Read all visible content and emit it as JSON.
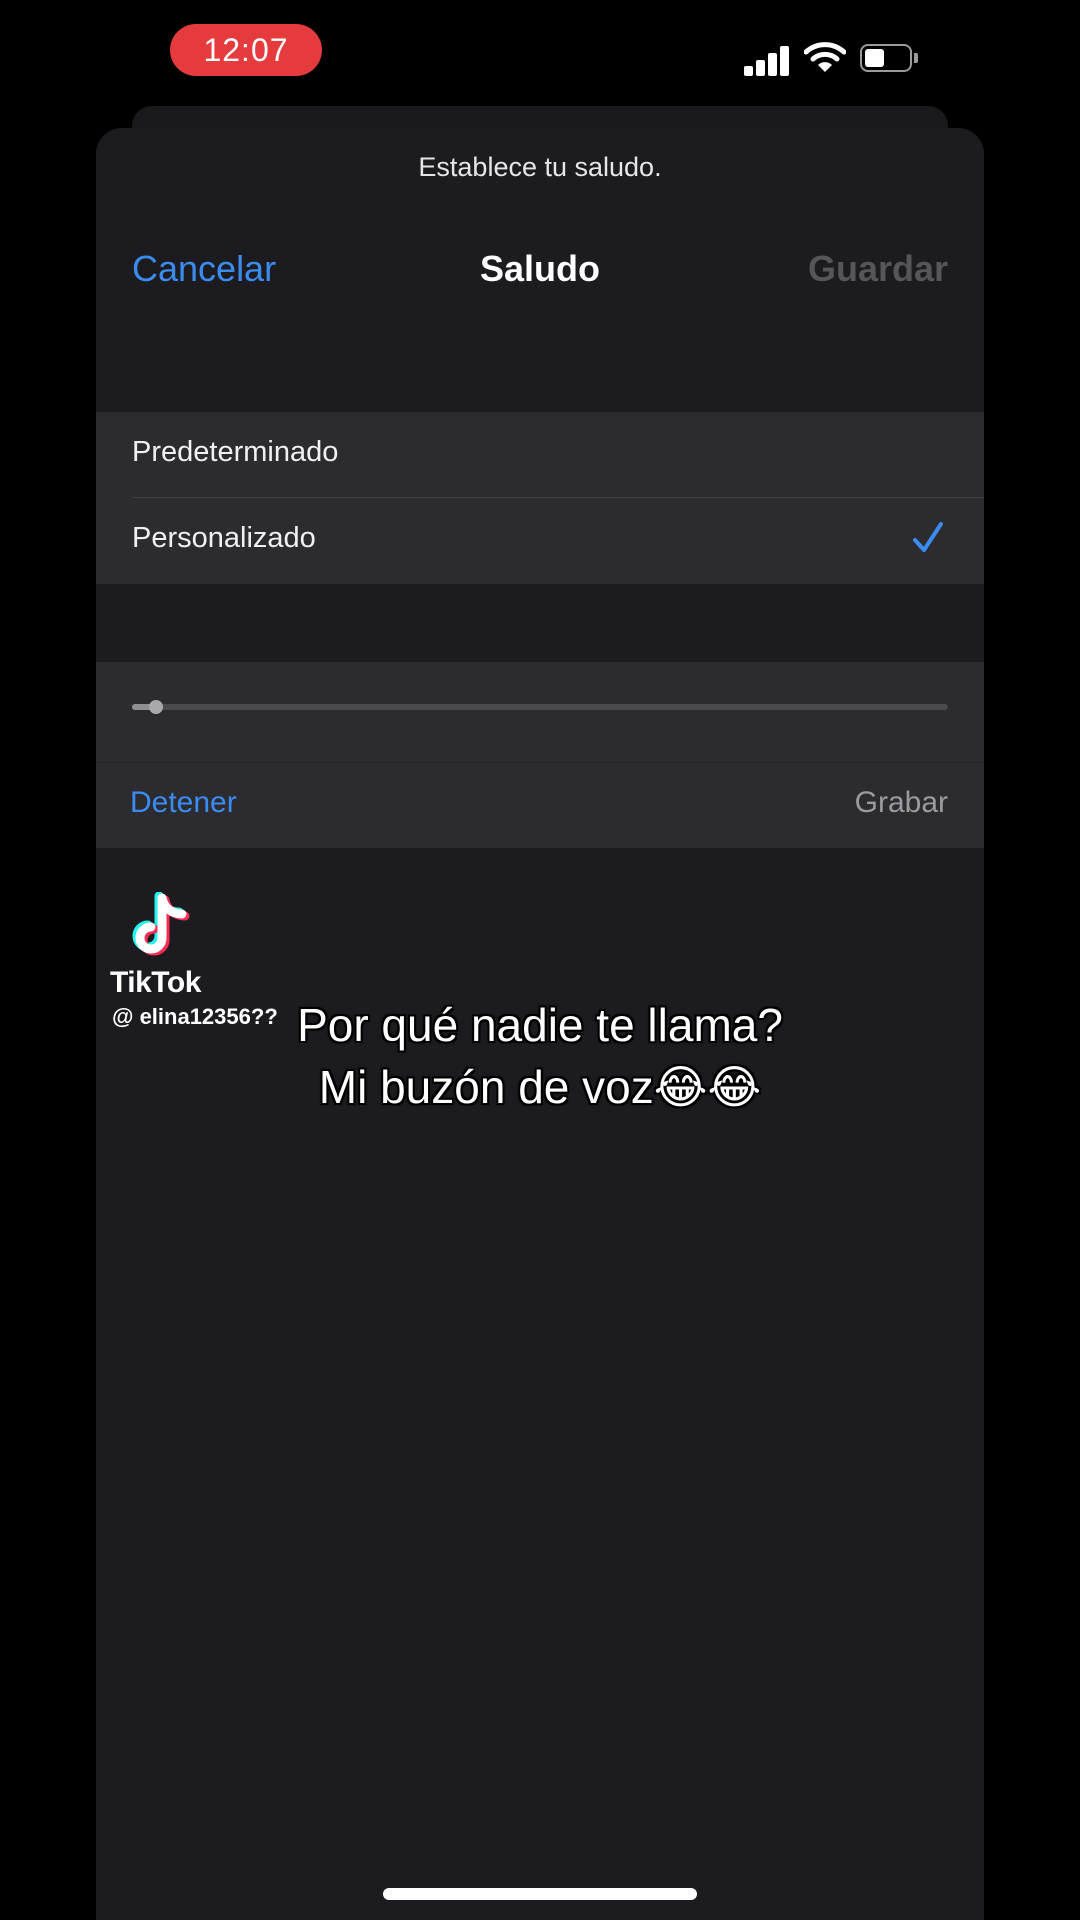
{
  "status_bar": {
    "time": "12:07",
    "signal_icon": "cellular-signal-icon",
    "wifi_icon": "wifi-icon",
    "battery_icon": "battery-icon",
    "battery_level": 0.45,
    "time_pill_color": "#e53b3d"
  },
  "sheet": {
    "prompt": "Establece tu saludo.",
    "nav": {
      "cancel_label": "Cancelar",
      "title": "Saludo",
      "save_label": "Guardar"
    },
    "options": [
      {
        "label": "Predeterminado",
        "selected": false
      },
      {
        "label": "Personalizado",
        "selected": true
      }
    ],
    "checkmark_icon": "checkmark-icon",
    "player": {
      "progress": 0.03,
      "stop_label": "Detener",
      "record_label": "Grabar"
    }
  },
  "overlay": {
    "tiktok_logo": "tiktok-logo-icon",
    "tiktok_name": "TikTok",
    "tiktok_handle": "@ elina12356??",
    "caption_line1": "Por qué nadie te llama?",
    "caption_line2": "Mi buzón de voz😂😂"
  },
  "colors": {
    "accent_blue": "#3b8cf0",
    "sheet_bg": "#1c1c20",
    "group_bg": "#2c2c30",
    "disabled_text": "#55555a"
  }
}
